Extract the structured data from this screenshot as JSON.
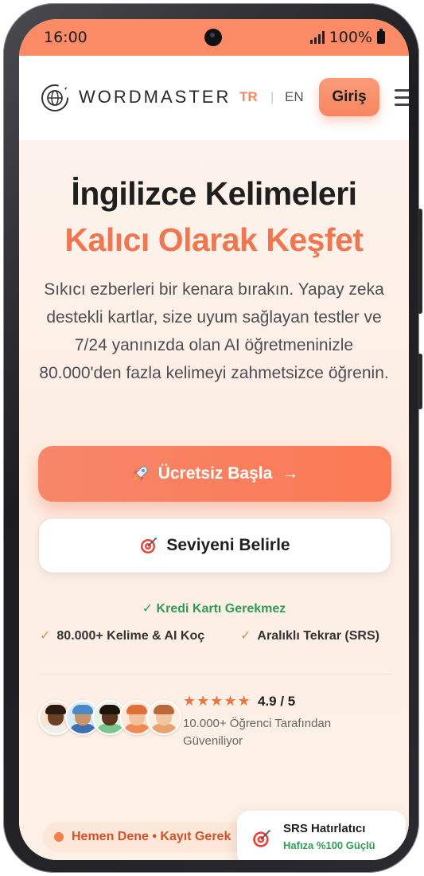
{
  "status_bar": {
    "time": "16:00",
    "battery": "100%"
  },
  "nav": {
    "brand": "WORDMASTER",
    "lang_tr": "TR",
    "lang_sep": "|",
    "lang_en": "EN",
    "login_label": "Giriş"
  },
  "hero": {
    "title_line1": "İngilizce Kelimeleri",
    "title_line2": "Kalıcı Olarak Keşfet",
    "description": "Sıkıcı ezberleri bir kenara bırakın. Yapay zeka destekli kartlar, size uyum sağlayan testler ve 7/24 yanınızda olan AI öğretmeninizle 80.000'den fazla kelimeyi zahmetsizce öğrenin.",
    "cta_primary": "Ücretsiz Başla",
    "cta_primary_arrow": "→",
    "cta_secondary": "Seviyeni Belirle",
    "no_card": "✓ Kredi Kartı Gerekmez",
    "features": [
      "80.000+ Kelime & AI Koç",
      "Aralıklı Tekrar (SRS)"
    ]
  },
  "social_proof": {
    "stars": "★★★★★",
    "rating": "4.9 / 5",
    "trust_text": "10.000+ Öğrenci Tarafından Güveniliyor"
  },
  "bottom": {
    "pill_text": "Hemen Dene • Kayıt Gerek",
    "srs_title": "SRS Hatırlatıcı",
    "srs_subtitle": "Hafıza %100 Güçlü"
  },
  "colors": {
    "accent": "#f57d56",
    "green": "#2f9b55",
    "status_bar": "#fb8b66"
  },
  "icons": [
    "globe-logo-icon",
    "menu-icon",
    "rocket-icon",
    "arrow-right-icon",
    "target-icon",
    "check-icon"
  ]
}
